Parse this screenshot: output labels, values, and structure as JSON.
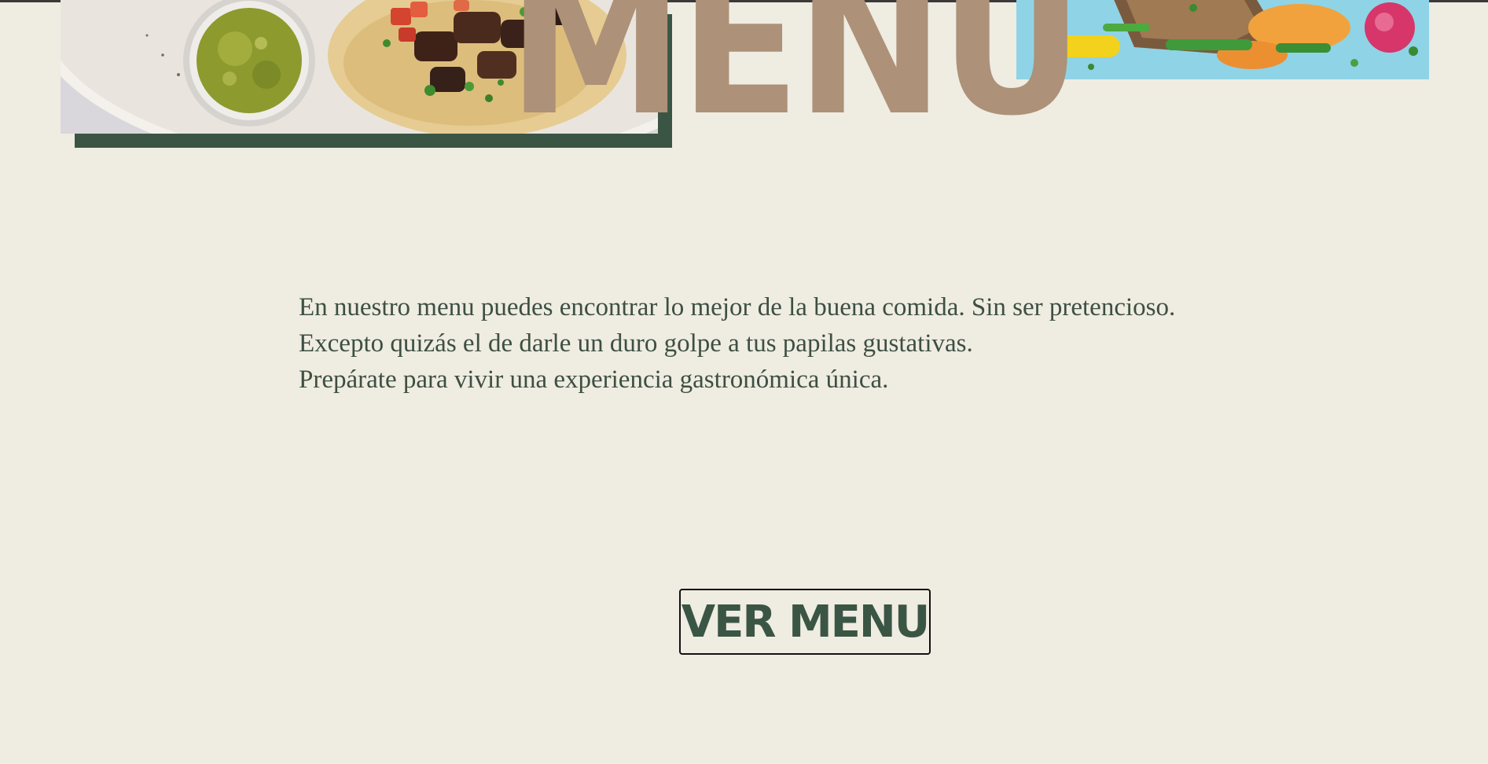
{
  "hero": {
    "title": "MENU"
  },
  "intro": {
    "lines": [
      "En nuestro menu puedes encontrar lo mejor de la buena comida. Sin ser pretencioso.",
      "Excepto quizás el de darle un duro golpe a tus papilas gustativas.",
      "Prepárate para vivir una experiencia gastronómica única."
    ]
  },
  "cta": {
    "label": "VER MENU"
  },
  "images": {
    "left": "tacos-salsa-verde-photo",
    "right": "fish-vegetables-photo"
  },
  "colors": {
    "background": "#efece2",
    "accent_green": "#3b5545",
    "title_tan": "#ad9178",
    "text": "#3d4f42"
  }
}
